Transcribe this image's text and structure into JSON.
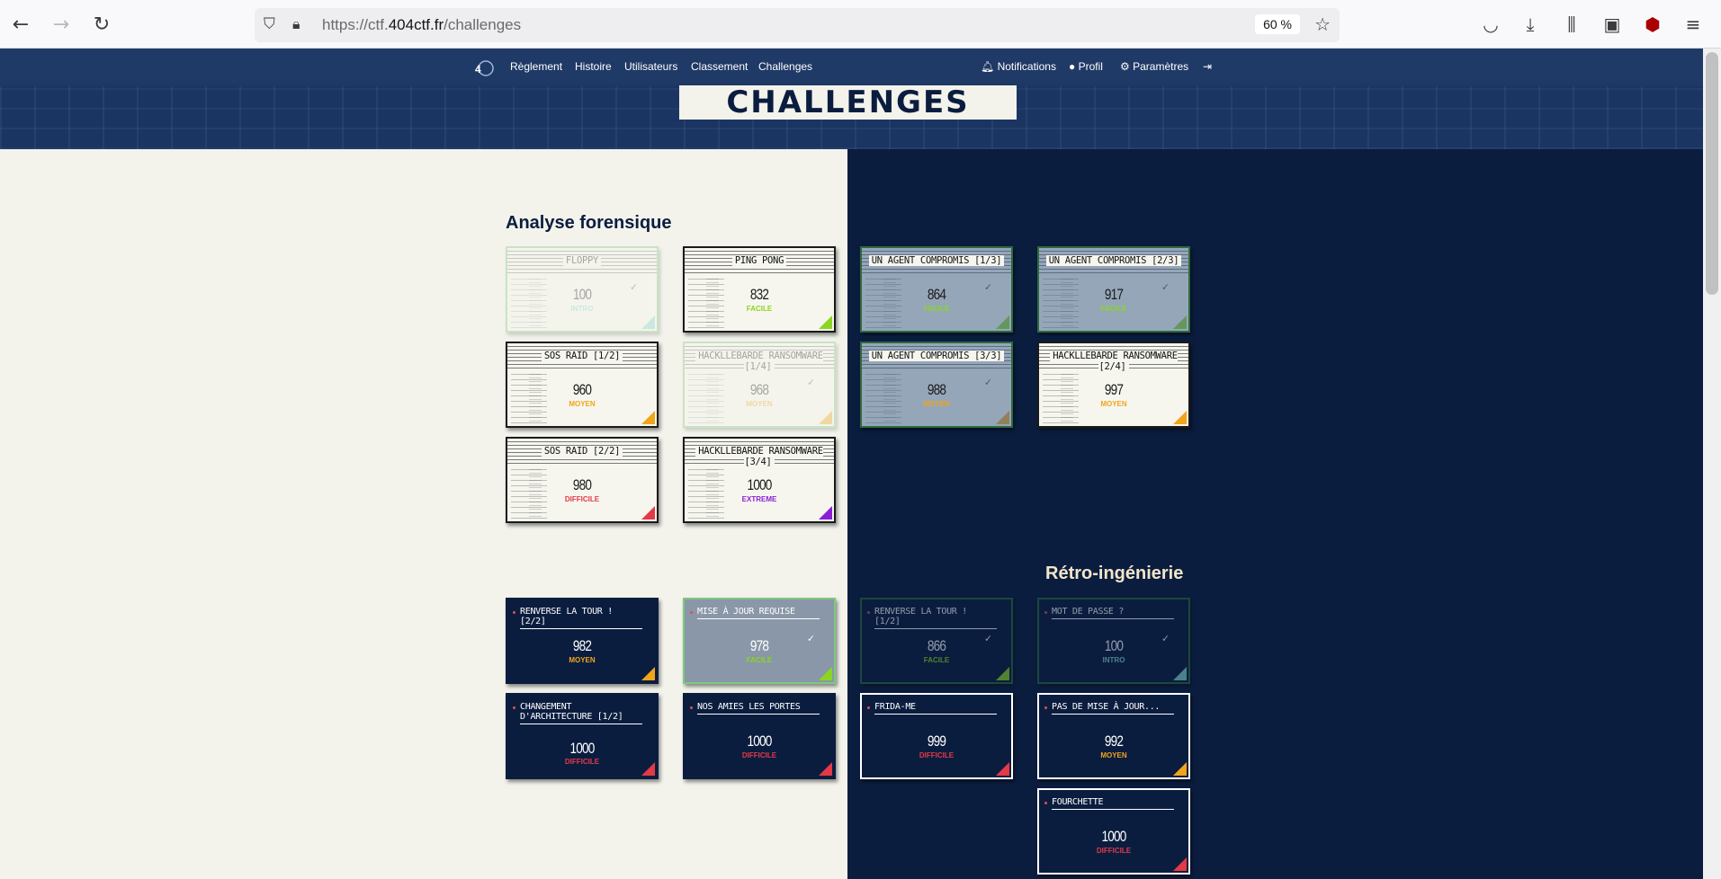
{
  "browser": {
    "url_prefix": "https://ctf.",
    "url_domain": "404ctf.fr",
    "url_path": "/challenges",
    "zoom": "60 %"
  },
  "nav": {
    "left": [
      "Règlement",
      "Histoire",
      "Utilisateurs",
      "Classement",
      "Challenges"
    ],
    "notifications": "Notifications",
    "profil": "Profil",
    "parametres": "Paramètres"
  },
  "banner_title": "CHALLENGES",
  "sections": {
    "forensic": "Analyse forensique",
    "reverse": "Rétro-ingénierie"
  },
  "colors": {
    "intro": "#7fd6c8",
    "facile": "#8bd61f",
    "moyen": "#f0a51a",
    "difficile": "#e53946",
    "extreme": "#8b1fd6"
  },
  "forensic_cards": [
    {
      "title": "FLOPPY",
      "points": "100",
      "level": "INTRO",
      "state": "faded",
      "check": "✓"
    },
    {
      "title": "PING PONG",
      "points": "832",
      "level": "FACILE",
      "state": "normal",
      "check": ""
    },
    {
      "title": "UN AGENT COMPROMIS [1/3]",
      "points": "864",
      "level": "FACILE",
      "state": "solved",
      "check": "✓"
    },
    {
      "title": "UN AGENT COMPROMIS [2/3]",
      "points": "917",
      "level": "FACILE",
      "state": "solved",
      "check": "✓"
    },
    {
      "title": "SOS RAID [1/2]",
      "points": "960",
      "level": "MOYEN",
      "state": "normal",
      "check": ""
    },
    {
      "title": "HACKLLEBARDE RANSOMWARE [1/4]",
      "points": "968",
      "level": "MOYEN",
      "state": "faded",
      "check": "✓"
    },
    {
      "title": "UN AGENT COMPROMIS [3/3]",
      "points": "988",
      "level": "MOYEN",
      "state": "solved",
      "check": "✓"
    },
    {
      "title": "HACKLLEBARDE RANSOMWARE [2/4]",
      "points": "997",
      "level": "MOYEN",
      "state": "normal",
      "check": ""
    },
    {
      "title": "SOS RAID [2/2]",
      "points": "980",
      "level": "DIFFICILE",
      "state": "normal",
      "check": ""
    },
    {
      "title": "HACKLLEBARDE RANSOMWARE [3/4]",
      "points": "1000",
      "level": "EXTREME",
      "state": "normal",
      "check": ""
    }
  ],
  "reverse_cards": [
    {
      "title": "RENVERSE LA TOUR ! [2/2]",
      "points": "982",
      "level": "MOYEN",
      "state": "normal",
      "check": ""
    },
    {
      "title": "MISE À JOUR REQUISE",
      "points": "978",
      "level": "FACILE",
      "state": "grey",
      "check": "✓"
    },
    {
      "title": "RENVERSE LA TOUR ! [1/2]",
      "points": "866",
      "level": "FACILE",
      "state": "faded",
      "check": "✓"
    },
    {
      "title": "MOT DE PASSE ?",
      "points": "100",
      "level": "INTRO",
      "state": "faded",
      "check": "✓"
    },
    {
      "title": "CHANGEMENT D'ARCHITECTURE [1/2]",
      "points": "1000",
      "level": "DIFFICILE",
      "state": "normal",
      "check": ""
    },
    {
      "title": "NOS AMIES LES PORTES",
      "points": "1000",
      "level": "DIFFICILE",
      "state": "normal",
      "check": ""
    },
    {
      "title": "FRIDA-ME",
      "points": "999",
      "level": "DIFFICILE",
      "state": "outlined",
      "check": ""
    },
    {
      "title": "PAS DE MISE À JOUR...",
      "points": "992",
      "level": "MOYEN",
      "state": "outlined",
      "check": ""
    },
    {
      "title": "FOURCHETTE",
      "points": "1000",
      "level": "DIFFICILE",
      "state": "outlined",
      "check": ""
    }
  ]
}
